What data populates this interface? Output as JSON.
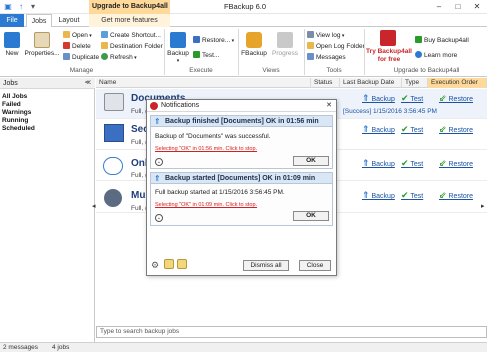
{
  "app": {
    "title": "FBackup 6.0"
  },
  "context_tab": "Upgrade to Backup4all",
  "tabs": {
    "file": "File",
    "jobs": "Jobs",
    "layout": "Layout",
    "more": "Get more features"
  },
  "ribbon": {
    "new": "New",
    "properties": "Properties...",
    "open": "Open",
    "delete": "Delete",
    "duplicate": "Duplicate",
    "create_shortcut": "Create Shortcut...",
    "destination_folder": "Destination Folder",
    "refresh": "Refresh",
    "manage": "Manage",
    "backup": "Backup",
    "restore": "Restore...",
    "test": "Test...",
    "execute": "Execute",
    "fbackup": "FBackup",
    "progress": "Progress",
    "views": "Views",
    "view_log": "View log",
    "open_log_folder": "Open Log Folder",
    "messages": "Messages",
    "tools": "Tools",
    "try_line1": "Try Backup4all",
    "try_line2": "for free",
    "buy": "Buy Backup4all",
    "learn_more": "Learn more",
    "upgrade_group": "Upgrade to Backup4all"
  },
  "left_panel": {
    "header": "Jobs",
    "items": [
      "All Jobs",
      "Failed",
      "Warnings",
      "Running",
      "Scheduled"
    ]
  },
  "columns": [
    "Name",
    "Status",
    "Last Backup Date",
    "Type",
    "Execution Order"
  ],
  "jobs": [
    {
      "name": "Documents",
      "sub": "Full, (",
      "last": "[Success] 1/15/2016 3:56:45 PM",
      "backup": "Backup",
      "test": "Test",
      "restore": "Restore",
      "icon": "briefcase-icon"
    },
    {
      "name": "Sec",
      "sub": "Full, (",
      "last": "",
      "backup": "Backup",
      "test": "Test",
      "restore": "Restore",
      "icon": "monitor-icon"
    },
    {
      "name": "Onl",
      "sub": "Full, (",
      "last": "",
      "backup": "Backup",
      "test": "Test",
      "restore": "Restore",
      "icon": "cloud-icon"
    },
    {
      "name": "Mu",
      "sub": "Full, (",
      "last": "",
      "backup": "Backup",
      "test": "Test",
      "restore": "Restore",
      "icon": "music-icon"
    }
  ],
  "search_placeholder": "Type to search backup jobs",
  "status": {
    "messages": "2 messages",
    "jobs": "4 jobs"
  },
  "notifications": {
    "title": "Notifications",
    "cards": [
      {
        "head": "Backup finished [Documents] OK in 01:56 min",
        "text": "Backup of \"Documents\" was successful.",
        "link": "Selecting \"OK\" in 01:56 min. Click to stop.",
        "ok": "OK"
      },
      {
        "head": "Backup started [Documents] OK in 01:09 min",
        "text": "Full backup started at 1/15/2016 3:56:45 PM.",
        "link": "Selecting \"OK\" in 01:09 min. Click to stop.",
        "ok": "OK"
      }
    ],
    "dismiss_all": "Dismiss all",
    "close": "Close"
  },
  "colors": {
    "accent": "#2b7ad1",
    "upgrade": "#ffd99a",
    "green": "#2a9a2a",
    "red": "#c8262a"
  }
}
